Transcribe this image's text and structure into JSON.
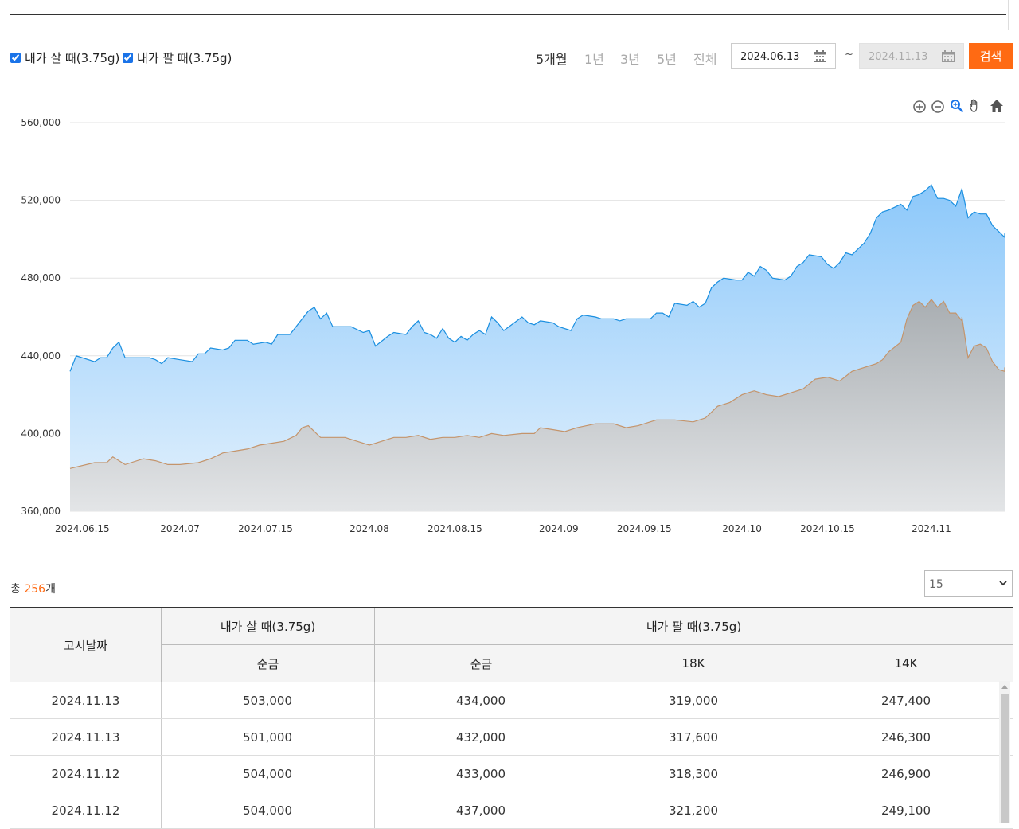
{
  "legend": {
    "buy_label": "내가 살 때(3.75g)",
    "sell_label": "내가 팔 때(3.75g)"
  },
  "periods": [
    "5개월",
    "1년",
    "3년",
    "5년",
    "전체"
  ],
  "date_range": {
    "start": "2024.06.13",
    "tilde": "~",
    "end": "2024.11.13",
    "search_label": "검색"
  },
  "chart_tools": [
    "zoom-in-icon",
    "zoom-out-icon",
    "magnifier-icon",
    "pan-hand-icon",
    "home-icon"
  ],
  "colors": {
    "buy_line": "#1a8fe0",
    "buy_fill": "#a6d4fb",
    "sell_line": "#c4946b",
    "sell_fill": "#c3c7ca",
    "accent": "#ff6a13"
  },
  "chart_data": {
    "type": "area",
    "ylim": [
      360000,
      560000
    ],
    "y_ticks": [
      "560,000",
      "520,000",
      "480,000",
      "440,000",
      "400,000",
      "360,000"
    ],
    "y_tick_values": [
      560000,
      520000,
      480000,
      440000,
      400000,
      360000
    ],
    "x_ticks": [
      "2024.06.15",
      "2024.07",
      "2024.07.15",
      "2024.08",
      "2024.08.15",
      "2024.09",
      "2024.09.15",
      "2024.10",
      "2024.10.15",
      "2024.11"
    ],
    "x_tick_dates": [
      "2024-06-15",
      "2024-07-01",
      "2024-07-15",
      "2024-08-01",
      "2024-08-15",
      "2024-09-01",
      "2024-09-15",
      "2024-10-01",
      "2024-10-15",
      "2024-11-01"
    ],
    "x_range": [
      "2024-06-13",
      "2024-11-13"
    ],
    "grid": true,
    "series": [
      {
        "name": "내가 살 때(3.75g)",
        "points": [
          [
            "2024-06-13",
            432000
          ],
          [
            "2024-06-14",
            440000
          ],
          [
            "2024-06-17",
            437000
          ],
          [
            "2024-06-18",
            439000
          ],
          [
            "2024-06-19",
            439000
          ],
          [
            "2024-06-20",
            444000
          ],
          [
            "2024-06-21",
            447000
          ],
          [
            "2024-06-22",
            439000
          ],
          [
            "2024-06-26",
            439000
          ],
          [
            "2024-06-27",
            438000
          ],
          [
            "2024-06-28",
            436000
          ],
          [
            "2024-06-29",
            439000
          ],
          [
            "2024-07-01",
            438000
          ],
          [
            "2024-07-03",
            437000
          ],
          [
            "2024-07-04",
            441000
          ],
          [
            "2024-07-05",
            441000
          ],
          [
            "2024-07-06",
            444000
          ],
          [
            "2024-07-08",
            443000
          ],
          [
            "2024-07-09",
            444000
          ],
          [
            "2024-07-10",
            448000
          ],
          [
            "2024-07-12",
            448000
          ],
          [
            "2024-07-13",
            446000
          ],
          [
            "2024-07-15",
            447000
          ],
          [
            "2024-07-16",
            446000
          ],
          [
            "2024-07-17",
            451000
          ],
          [
            "2024-07-19",
            451000
          ],
          [
            "2024-07-20",
            455000
          ],
          [
            "2024-07-21",
            459000
          ],
          [
            "2024-07-22",
            463000
          ],
          [
            "2024-07-23",
            465000
          ],
          [
            "2024-07-24",
            459000
          ],
          [
            "2024-07-25",
            462000
          ],
          [
            "2024-07-26",
            455000
          ],
          [
            "2024-07-29",
            455000
          ],
          [
            "2024-07-31",
            452000
          ],
          [
            "2024-08-01",
            453000
          ],
          [
            "2024-08-02",
            445000
          ],
          [
            "2024-08-04",
            450000
          ],
          [
            "2024-08-05",
            452000
          ],
          [
            "2024-08-07",
            451000
          ],
          [
            "2024-08-08",
            455000
          ],
          [
            "2024-08-09",
            458000
          ],
          [
            "2024-08-10",
            452000
          ],
          [
            "2024-08-11",
            451000
          ],
          [
            "2024-08-12",
            449000
          ],
          [
            "2024-08-13",
            454000
          ],
          [
            "2024-08-14",
            449000
          ],
          [
            "2024-08-15",
            447000
          ],
          [
            "2024-08-16",
            450000
          ],
          [
            "2024-08-17",
            448000
          ],
          [
            "2024-08-18",
            451000
          ],
          [
            "2024-08-19",
            453000
          ],
          [
            "2024-08-20",
            451000
          ],
          [
            "2024-08-21",
            460000
          ],
          [
            "2024-08-22",
            457000
          ],
          [
            "2024-08-23",
            453000
          ],
          [
            "2024-08-26",
            460000
          ],
          [
            "2024-08-27",
            457000
          ],
          [
            "2024-08-28",
            456000
          ],
          [
            "2024-08-29",
            458000
          ],
          [
            "2024-08-31",
            457000
          ],
          [
            "2024-09-01",
            455000
          ],
          [
            "2024-09-03",
            453000
          ],
          [
            "2024-09-04",
            459000
          ],
          [
            "2024-09-05",
            461000
          ],
          [
            "2024-09-07",
            460000
          ],
          [
            "2024-09-08",
            459000
          ],
          [
            "2024-09-10",
            459000
          ],
          [
            "2024-09-11",
            458000
          ],
          [
            "2024-09-12",
            459000
          ],
          [
            "2024-09-14",
            459000
          ],
          [
            "2024-09-16",
            459000
          ],
          [
            "2024-09-17",
            462000
          ],
          [
            "2024-09-18",
            462000
          ],
          [
            "2024-09-19",
            460000
          ],
          [
            "2024-09-20",
            467000
          ],
          [
            "2024-09-22",
            466000
          ],
          [
            "2024-09-23",
            468000
          ],
          [
            "2024-09-24",
            465000
          ],
          [
            "2024-09-25",
            467000
          ],
          [
            "2024-09-26",
            475000
          ],
          [
            "2024-09-27",
            478000
          ],
          [
            "2024-09-28",
            480000
          ],
          [
            "2024-09-30",
            479000
          ],
          [
            "2024-10-01",
            479000
          ],
          [
            "2024-10-02",
            483000
          ],
          [
            "2024-10-03",
            481000
          ],
          [
            "2024-10-04",
            486000
          ],
          [
            "2024-10-05",
            484000
          ],
          [
            "2024-10-06",
            480000
          ],
          [
            "2024-10-08",
            479000
          ],
          [
            "2024-10-09",
            481000
          ],
          [
            "2024-10-10",
            486000
          ],
          [
            "2024-10-11",
            488000
          ],
          [
            "2024-10-12",
            492000
          ],
          [
            "2024-10-14",
            491000
          ],
          [
            "2024-10-15",
            487000
          ],
          [
            "2024-10-16",
            485000
          ],
          [
            "2024-10-17",
            488000
          ],
          [
            "2024-10-18",
            493000
          ],
          [
            "2024-10-19",
            492000
          ],
          [
            "2024-10-21",
            498000
          ],
          [
            "2024-10-22",
            503000
          ],
          [
            "2024-10-23",
            511000
          ],
          [
            "2024-10-24",
            514000
          ],
          [
            "2024-10-25",
            515000
          ],
          [
            "2024-10-27",
            518000
          ],
          [
            "2024-10-28",
            515000
          ],
          [
            "2024-10-29",
            522000
          ],
          [
            "2024-10-30",
            523000
          ],
          [
            "2024-10-31",
            525000
          ],
          [
            "2024-11-01",
            528000
          ],
          [
            "2024-11-02",
            521000
          ],
          [
            "2024-11-03",
            521000
          ],
          [
            "2024-11-04",
            520000
          ],
          [
            "2024-11-05",
            517000
          ],
          [
            "2024-11-06",
            526000
          ],
          [
            "2024-11-07",
            511000
          ],
          [
            "2024-11-08",
            514000
          ],
          [
            "2024-11-09",
            513000
          ],
          [
            "2024-11-10",
            513000
          ],
          [
            "2024-11-11",
            507000
          ],
          [
            "2024-11-12",
            504000
          ],
          [
            "2024-11-13",
            501000
          ],
          [
            "2024-11-13",
            503000
          ]
        ]
      },
      {
        "name": "내가 팔 때(3.75g)",
        "points": [
          [
            "2024-06-13",
            382000
          ],
          [
            "2024-06-17",
            385000
          ],
          [
            "2024-06-19",
            385000
          ],
          [
            "2024-06-20",
            388000
          ],
          [
            "2024-06-22",
            384000
          ],
          [
            "2024-06-25",
            387000
          ],
          [
            "2024-06-27",
            386000
          ],
          [
            "2024-06-29",
            384000
          ],
          [
            "2024-07-01",
            384000
          ],
          [
            "2024-07-04",
            385000
          ],
          [
            "2024-07-06",
            387000
          ],
          [
            "2024-07-08",
            390000
          ],
          [
            "2024-07-10",
            391000
          ],
          [
            "2024-07-12",
            392000
          ],
          [
            "2024-07-14",
            394000
          ],
          [
            "2024-07-16",
            395000
          ],
          [
            "2024-07-18",
            396000
          ],
          [
            "2024-07-20",
            399000
          ],
          [
            "2024-07-21",
            403000
          ],
          [
            "2024-07-22",
            404000
          ],
          [
            "2024-07-24",
            398000
          ],
          [
            "2024-07-26",
            398000
          ],
          [
            "2024-07-28",
            398000
          ],
          [
            "2024-07-30",
            396000
          ],
          [
            "2024-08-01",
            394000
          ],
          [
            "2024-08-03",
            396000
          ],
          [
            "2024-08-05",
            398000
          ],
          [
            "2024-08-07",
            398000
          ],
          [
            "2024-08-09",
            399000
          ],
          [
            "2024-08-11",
            397000
          ],
          [
            "2024-08-13",
            398000
          ],
          [
            "2024-08-15",
            398000
          ],
          [
            "2024-08-17",
            399000
          ],
          [
            "2024-08-19",
            398000
          ],
          [
            "2024-08-21",
            400000
          ],
          [
            "2024-08-23",
            399000
          ],
          [
            "2024-08-26",
            400000
          ],
          [
            "2024-08-28",
            400000
          ],
          [
            "2024-08-29",
            403000
          ],
          [
            "2024-08-31",
            402000
          ],
          [
            "2024-09-02",
            401000
          ],
          [
            "2024-09-04",
            403000
          ],
          [
            "2024-09-07",
            405000
          ],
          [
            "2024-09-10",
            405000
          ],
          [
            "2024-09-12",
            403000
          ],
          [
            "2024-09-14",
            404000
          ],
          [
            "2024-09-17",
            407000
          ],
          [
            "2024-09-20",
            407000
          ],
          [
            "2024-09-23",
            406000
          ],
          [
            "2024-09-25",
            408000
          ],
          [
            "2024-09-27",
            414000
          ],
          [
            "2024-09-29",
            416000
          ],
          [
            "2024-10-01",
            420000
          ],
          [
            "2024-10-03",
            422000
          ],
          [
            "2024-10-05",
            420000
          ],
          [
            "2024-10-07",
            419000
          ],
          [
            "2024-10-09",
            421000
          ],
          [
            "2024-10-11",
            423000
          ],
          [
            "2024-10-13",
            428000
          ],
          [
            "2024-10-15",
            429000
          ],
          [
            "2024-10-17",
            427000
          ],
          [
            "2024-10-19",
            432000
          ],
          [
            "2024-10-21",
            434000
          ],
          [
            "2024-10-23",
            436000
          ],
          [
            "2024-10-24",
            438000
          ],
          [
            "2024-10-25",
            442000
          ],
          [
            "2024-10-27",
            447000
          ],
          [
            "2024-10-28",
            459000
          ],
          [
            "2024-10-29",
            466000
          ],
          [
            "2024-10-30",
            468000
          ],
          [
            "2024-10-31",
            465000
          ],
          [
            "2024-11-01",
            469000
          ],
          [
            "2024-11-02",
            465000
          ],
          [
            "2024-11-03",
            468000
          ],
          [
            "2024-11-04",
            462000
          ],
          [
            "2024-11-05",
            462000
          ],
          [
            "2024-11-06",
            458000
          ],
          [
            "2024-11-06",
            460000
          ],
          [
            "2024-11-07",
            439000
          ],
          [
            "2024-11-08",
            445000
          ],
          [
            "2024-11-09",
            446000
          ],
          [
            "2024-11-10",
            444000
          ],
          [
            "2024-11-11",
            437000
          ],
          [
            "2024-11-12",
            433000
          ],
          [
            "2024-11-13",
            432000
          ],
          [
            "2024-11-13",
            434000
          ]
        ]
      }
    ]
  },
  "total": {
    "prefix": "총 ",
    "count": "256",
    "suffix": "개"
  },
  "page_size": "15",
  "table": {
    "date_header": "고시날짜",
    "buy_header": "내가 살 때(3.75g)",
    "sell_header": "내가 팔 때(3.75g)",
    "buy_sub": "순금",
    "sell_subs": [
      "순금",
      "18K",
      "14K"
    ],
    "rows": [
      [
        "2024.11.13",
        "503,000",
        "434,000",
        "319,000",
        "247,400"
      ],
      [
        "2024.11.13",
        "501,000",
        "432,000",
        "317,600",
        "246,300"
      ],
      [
        "2024.11.12",
        "504,000",
        "433,000",
        "318,300",
        "246,900"
      ],
      [
        "2024.11.12",
        "504,000",
        "437,000",
        "321,200",
        "249,100"
      ]
    ]
  }
}
